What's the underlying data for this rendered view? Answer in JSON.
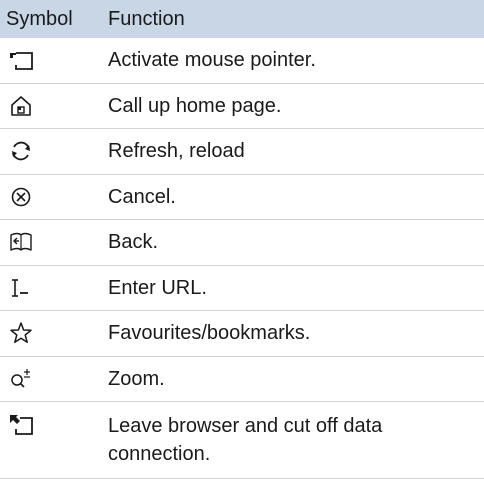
{
  "header": {
    "symbol": "Symbol",
    "function": "Function"
  },
  "rows": [
    {
      "icon": "mouse-pointer-icon",
      "function": "Activate mouse pointer."
    },
    {
      "icon": "home-icon",
      "function": "Call up home page."
    },
    {
      "icon": "refresh-icon",
      "function": "Refresh, reload"
    },
    {
      "icon": "cancel-icon",
      "function": "Cancel."
    },
    {
      "icon": "back-icon",
      "function": "Back."
    },
    {
      "icon": "enter-url-icon",
      "function": "Enter URL."
    },
    {
      "icon": "star-icon",
      "function": "Favourites/bookmarks."
    },
    {
      "icon": "zoom-icon",
      "function": "Zoom."
    },
    {
      "icon": "leave-browser-icon",
      "function": "Leave browser and cut off data connection."
    }
  ]
}
